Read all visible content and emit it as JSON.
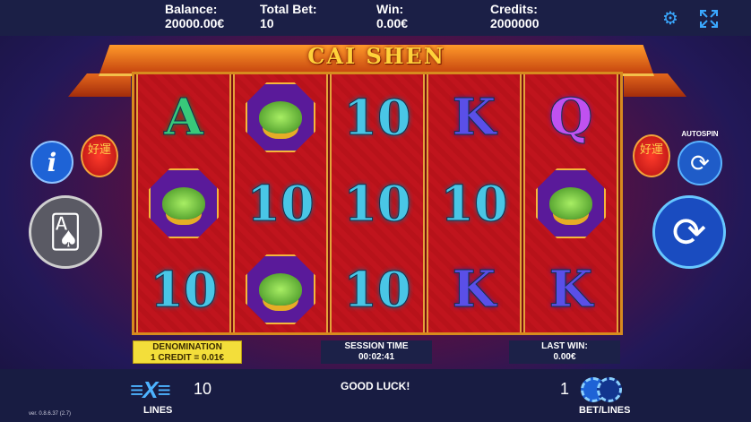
{
  "header": {
    "balance_label": "Balance:",
    "balance_value": "20000.00€",
    "total_bet_label": "Total Bet:",
    "total_bet_value": "10",
    "win_label": "Win:",
    "win_value": "0.00€",
    "credits_label": "Credits:",
    "credits_value": "2000000",
    "settings_icon": "gear-icon",
    "fullscreen_icon": "expand-icon"
  },
  "game": {
    "logo": "CAI SHEN",
    "lantern_text": "好運"
  },
  "reels": [
    [
      "A",
      "frog",
      "10"
    ],
    [
      "frog",
      "10",
      "frog"
    ],
    [
      "10",
      "10",
      "10"
    ],
    [
      "K",
      "10",
      "K"
    ],
    [
      "Q",
      "frog",
      "K"
    ]
  ],
  "buttons": {
    "info": "i",
    "autospin_label": "AUTOSPIN"
  },
  "info_strip": {
    "denomination_label": "DENOMINATION",
    "denomination_value": "1 CREDIT = 0.01€",
    "session_label": "SESSION TIME",
    "session_value": "00:02:41",
    "last_win_label": "LAST WIN:",
    "last_win_value": "0.00€"
  },
  "footer": {
    "lines_value": "10",
    "lines_label": "LINES",
    "message": "GOOD LUCK!",
    "bet_lines_value": "1",
    "bet_lines_label": "BET/LINES",
    "version": "ver. 0.8.6.37 (2.7)"
  }
}
